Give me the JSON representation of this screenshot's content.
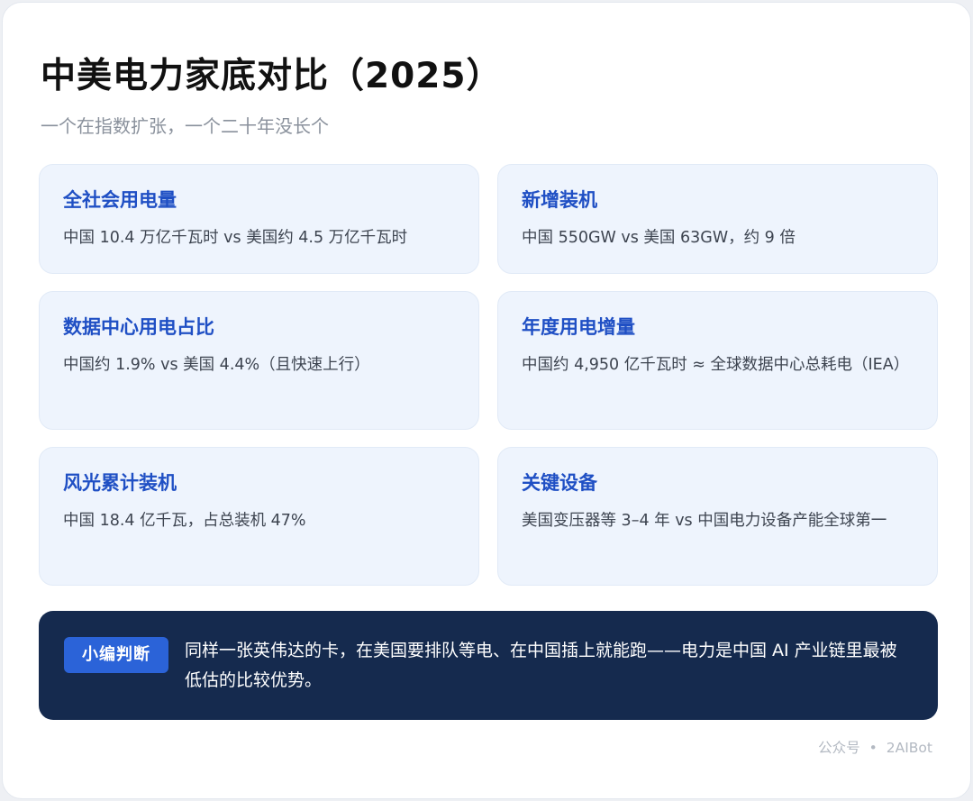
{
  "header": {
    "title": "中美电力家底对比（2025）",
    "subtitle": "一个在指数扩张，一个二十年没长个"
  },
  "stats": [
    {
      "label": "全社会用电量",
      "value": "中国 10.4 万亿千瓦时 vs 美国约 4.5 万亿千瓦时"
    },
    {
      "label": "新增装机",
      "value": "中国 550GW vs 美国 63GW，约 9 倍"
    },
    {
      "label": "数据中心用电占比",
      "value": "中国约 1.9% vs 美国 4.4%（且快速上行）"
    },
    {
      "label": "年度用电增量",
      "value": "中国约 4,950 亿千瓦时 ≈ 全球数据中心总耗电（IEA）"
    },
    {
      "label": "风光累计装机",
      "value": "中国 18.4 亿千瓦，占总装机 47%"
    },
    {
      "label": "关键设备",
      "value": "美国变压器等 3–4 年 vs 中国电力设备产能全球第一"
    }
  ],
  "verdict": {
    "badge": "小编判断",
    "text": "同样一张英伟达的卡，在美国要排队等电、在中国插上就能跑——电力是中国 AI 产业链里最被低估的比较优势。"
  },
  "footer": {
    "platform": "公众号",
    "separator": "•",
    "account": "2AIBot"
  }
}
